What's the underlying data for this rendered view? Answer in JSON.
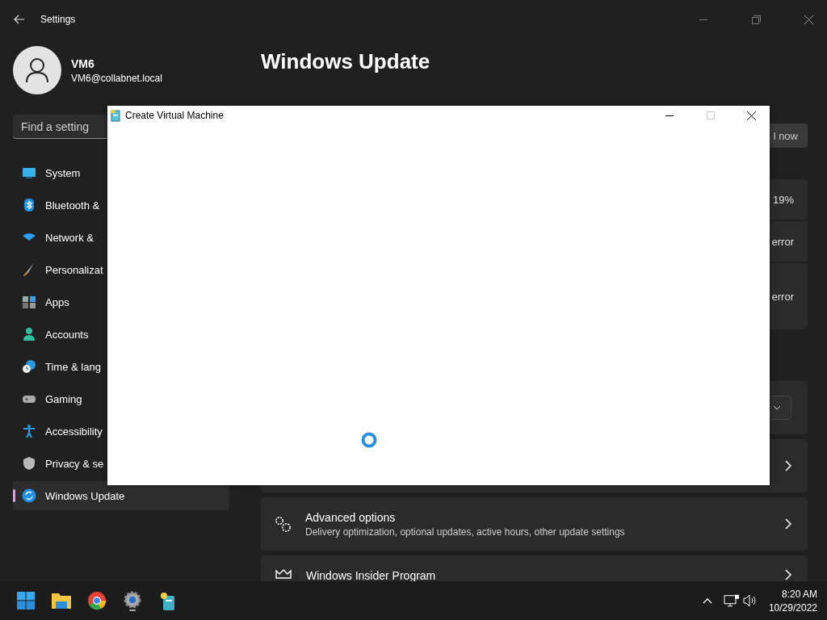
{
  "settings_window": {
    "title": "Settings",
    "user": {
      "name": "VM6",
      "email": "VM6@collabnet.local"
    },
    "search": {
      "placeholder": "Find a setting"
    },
    "nav": [
      {
        "label": "System",
        "selected": false
      },
      {
        "label": "Bluetooth &",
        "selected": false
      },
      {
        "label": "Network &",
        "selected": false
      },
      {
        "label": "Personalizat",
        "selected": false
      },
      {
        "label": "Apps",
        "selected": false
      },
      {
        "label": "Accounts",
        "selected": false
      },
      {
        "label": "Time & lang",
        "selected": false
      },
      {
        "label": "Gaming",
        "selected": false
      },
      {
        "label": "Accessibility",
        "selected": false
      },
      {
        "label": "Privacy & se",
        "selected": false
      },
      {
        "label": "Windows Update",
        "selected": true
      }
    ],
    "page_title": "Windows Update",
    "install_button": "l now",
    "status_rows": [
      {
        "text": "19%"
      },
      {
        "text": "error"
      },
      {
        "text": "error"
      }
    ],
    "option_cards": [
      {
        "kind": "dropdown"
      },
      {
        "kind": "link"
      },
      {
        "kind": "link",
        "title": "Advanced options",
        "subtitle": "Delivery optimization, optional updates, active hours, other update settings"
      },
      {
        "kind": "link",
        "title": "Windows Insider Program"
      }
    ]
  },
  "dialog": {
    "title": "Create Virtual Machine"
  },
  "taskbar": {
    "time": "8:20 AM",
    "date": "10/29/2022"
  }
}
